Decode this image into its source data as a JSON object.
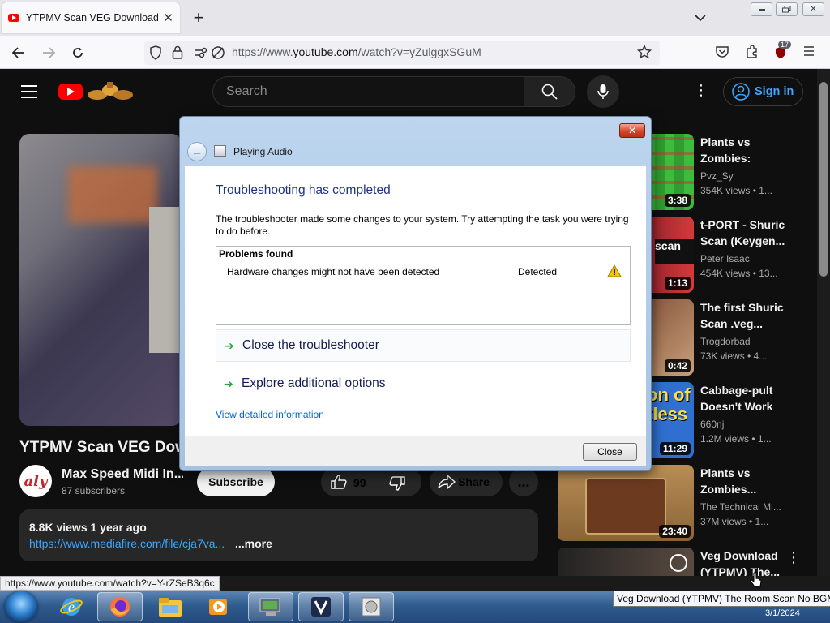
{
  "browser": {
    "tab_title": "YTPMV Scan VEG Download - \\",
    "url_prefix": "https://www.",
    "url_domain": "youtube.com",
    "url_path": "/watch?v=yZulggxSGuM",
    "ext_badge": "17",
    "status_url": "https://www.youtube.com/watch?v=Y-rZSeB3q6c"
  },
  "youtube": {
    "search_placeholder": "Search",
    "sign_in": "Sign in",
    "video_title": "YTPMV Scan VEG Download",
    "channel_name": "Max Speed Midi In...",
    "channel_avatar": "aly",
    "subscribers": "87 subscribers",
    "subscribe": "Subscribe",
    "likes": "99",
    "share": "Share",
    "more": "...",
    "desc_stats": "8.8K views  1 year ago",
    "desc_link": "https://www.mediafire.com/file/cja7va...",
    "desc_more": "...more",
    "related": [
      {
        "title": "Plants vs Zombies:",
        "channel": "Pvz_Sy",
        "meta": "354K views  • 1...",
        "duration": "3:38"
      },
      {
        "title": "t-PORT - Shuric Scan (Keygen...",
        "channel": "Peter Isaac",
        "meta": "454K views  • 13...",
        "duration": "1:13"
      },
      {
        "title": "The first Shuric Scan .veg...",
        "channel": "Trogdorbad",
        "meta": "73K views  • 4...",
        "duration": "0:42"
      },
      {
        "title": "Cabbage-pult Doesn't Work i...",
        "channel": "660nj",
        "meta": "1.2M views  • 1...",
        "duration": "11:29"
      },
      {
        "title": "Plants vs Zombies...",
        "channel": "The Technical Mi...",
        "meta": "37M views  • 1...",
        "duration": "23:40"
      },
      {
        "title": "Veg Download (YTPMV) The...",
        "channel": "",
        "meta": "",
        "duration": ""
      }
    ]
  },
  "dialog": {
    "title": "Playing Audio",
    "heading": "Troubleshooting has completed",
    "message": "The troubleshooter made some changes to your system. Try attempting the task you were trying to do before.",
    "problems_header": "Problems found",
    "problem_text": "Hardware changes might not have been detected",
    "problem_status": "Detected",
    "option_close": "Close the troubleshooter",
    "option_explore": "Explore additional options",
    "view_details": "View detailed information",
    "close_button": "Close"
  },
  "taskbar": {
    "tooltip": "Veg Download (YTPMV) The Room Scan No BGM",
    "date": "3/1/2024"
  }
}
